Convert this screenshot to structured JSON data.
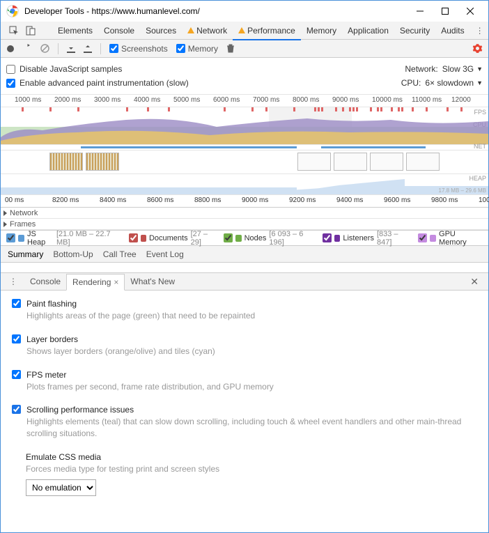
{
  "window": {
    "title": "Developer Tools - https://www.humanlevel.com/"
  },
  "main_tabs": [
    "Elements",
    "Console",
    "Sources",
    "Network",
    "Performance",
    "Memory",
    "Application",
    "Security",
    "Audits"
  ],
  "main_tabs_warn": {
    "Network": true,
    "Performance": true
  },
  "toolbar": {
    "screenshots_label": "Screenshots",
    "memory_label": "Memory"
  },
  "options": {
    "disable_js": "Disable JavaScript samples",
    "enable_paint": "Enable advanced paint instrumentation (slow)",
    "network_label": "Network:",
    "network_value": "Slow 3G",
    "cpu_label": "CPU:",
    "cpu_value": "6× slowdown"
  },
  "timeline": {
    "ruler1": [
      "1000 ms",
      "2000 ms",
      "3000 ms",
      "4000 ms",
      "5000 ms",
      "6000 ms",
      "7000 ms",
      "8000 ms",
      "9000 ms",
      "10000 ms",
      "11000 ms",
      "12000"
    ],
    "fps_label": "FPS",
    "cpu_label": "CPU",
    "net_label": "NET",
    "heap_label": "HEAP",
    "heap_range": "17.8 MB – 29.6 MB",
    "ruler2": [
      "00 ms",
      "8200 ms",
      "8400 ms",
      "8600 ms",
      "8800 ms",
      "9000 ms",
      "9200 ms",
      "9400 ms",
      "9600 ms",
      "9800 ms",
      "100"
    ],
    "rows": [
      "Network",
      "Frames"
    ]
  },
  "legend": [
    {
      "color": "#5b9bd5",
      "label": "JS Heap",
      "range": "[21.0 MB – 22.7 MB]"
    },
    {
      "color": "#c0504d",
      "label": "Documents",
      "range": "[27 – 29]"
    },
    {
      "color": "#70ad47",
      "label": "Nodes",
      "range": "[6 093 – 6 196]"
    },
    {
      "color": "#7030a0",
      "label": "Listeners",
      "range": "[833 – 847]"
    },
    {
      "color": "#c48be0",
      "label": "GPU Memory",
      "range": ""
    }
  ],
  "summary_tabs": [
    "Summary",
    "Bottom-Up",
    "Call Tree",
    "Event Log"
  ],
  "console_tabs": {
    "items": [
      "Console",
      "Rendering",
      "What's New"
    ],
    "active": "Rendering"
  },
  "rendering": [
    {
      "checked": true,
      "title": "Paint flashing",
      "desc": "Highlights areas of the page (green) that need to be repainted"
    },
    {
      "checked": true,
      "title": "Layer borders",
      "desc": "Shows layer borders (orange/olive) and tiles (cyan)"
    },
    {
      "checked": true,
      "title": "FPS meter",
      "desc": "Plots frames per second, frame rate distribution, and GPU memory"
    },
    {
      "checked": true,
      "highlight": true,
      "title": "Scrolling performance issues",
      "desc": "Highlights elements (teal) that can slow down scrolling, including touch & wheel event handlers and other main-thread scrolling situations."
    }
  ],
  "emulate": {
    "title": "Emulate CSS media",
    "desc": "Forces media type for testing print and screen styles",
    "select": "No emulation"
  }
}
